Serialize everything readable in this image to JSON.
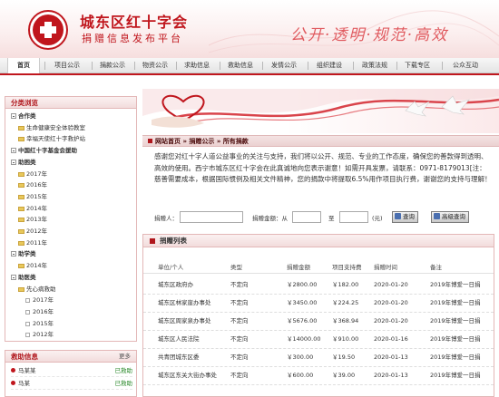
{
  "header": {
    "title": "城东区红十字会",
    "subtitle": "捐赠信息发布平台",
    "slogan": "公开·透明·规范·高效"
  },
  "nav": {
    "items": [
      "首页",
      "项目公示",
      "捐款公示",
      "物资公示",
      "求助信息",
      "救助信息",
      "发情公示",
      "组织建设",
      "政策法规",
      "下载专区",
      "公众互动"
    ],
    "active_index": 0
  },
  "sidebar": {
    "category_title": "分类浏览",
    "tree": [
      {
        "label": "合作类",
        "level": 0,
        "bold": true
      },
      {
        "label": "生命健康安全体验教室",
        "level": 1
      },
      {
        "label": "幸福天使红十字救护站",
        "level": 1
      },
      {
        "label": "中国红十字基金会援助",
        "level": 0,
        "bold": true
      },
      {
        "label": "助困类",
        "level": 0,
        "bold": true
      },
      {
        "label": "2017年",
        "level": 1
      },
      {
        "label": "2016年",
        "level": 1
      },
      {
        "label": "2015年",
        "level": 1
      },
      {
        "label": "2014年",
        "level": 1
      },
      {
        "label": "2013年",
        "level": 1
      },
      {
        "label": "2012年",
        "level": 1
      },
      {
        "label": "2011年",
        "level": 1
      },
      {
        "label": "助学类",
        "level": 0,
        "bold": true
      },
      {
        "label": "2014年",
        "level": 1
      },
      {
        "label": "助医类",
        "level": 0,
        "bold": true
      },
      {
        "label": "先心病救助",
        "level": 1
      },
      {
        "label": "2017年",
        "level": 2
      },
      {
        "label": "2016年",
        "level": 2
      },
      {
        "label": "2015年",
        "level": 2
      },
      {
        "label": "2012年",
        "level": 2
      }
    ],
    "help_title": "救助信息",
    "help_more": "更多",
    "help_items": [
      {
        "name": "马某某",
        "status": "已救助"
      },
      {
        "name": "马某",
        "status": "已救助"
      }
    ]
  },
  "breadcrumb": {
    "parts": [
      "网站首页",
      "捐赠公示",
      "所有捐款"
    ],
    "sep": "»"
  },
  "intro": "感谢您对红十字人道公益事业的关注与支持，我们将以公开、规范、专业的工作态度，确保您的善款得到透明、高效的使用。西宁市城东区红十字会在此真诚地向您表示谢意！如需开具发票，请联系：0971-8179013[注：慈善需要成本，根据国际惯例及相关文件精神，您的捐款中将提取6.5%用作项目执行费，谢谢您的支持与理解！",
  "search": {
    "donor_label": "捐赠人：",
    "donor_value": "",
    "amount_label": "捐赠金额：从",
    "amount_from": "",
    "to_label": "至",
    "amount_to": "",
    "unit": "(元)",
    "query_button": "查询",
    "advanced_button": "高级查询"
  },
  "list": {
    "title": "捐赠列表",
    "columns": [
      "单位/个人",
      "类型",
      "捐赠金额",
      "项目支持费",
      "捐赠时间",
      "备注"
    ],
    "rows": [
      [
        "城东区政府办",
        "不定向",
        "￥2800.00",
        "￥182.00",
        "2020-01-20",
        "2019年博爱一日捐"
      ],
      [
        "城东区林家崖办事处",
        "不定向",
        "￥3450.00",
        "￥224.25",
        "2020-01-20",
        "2019年博爱一日捐"
      ],
      [
        "城东区周家泉办事处",
        "不定向",
        "￥5676.00",
        "￥368.94",
        "2020-01-20",
        "2019年博爱一日捐"
      ],
      [
        "城东区人民法院",
        "不定向",
        "￥14000.00",
        "￥910.00",
        "2020-01-16",
        "2019年博爱一日捐"
      ],
      [
        "共青团城东区委",
        "不定向",
        "￥300.00",
        "￥19.50",
        "2020-01-13",
        "2019年博爱一日捐"
      ],
      [
        "城东区东关大街办事处",
        "不定向",
        "￥600.00",
        "￥39.00",
        "2020-01-13",
        "2019年博爱一日捐"
      ]
    ]
  },
  "colors": {
    "brand_red": "#c0161d",
    "status_green": "#2c8a2c"
  }
}
